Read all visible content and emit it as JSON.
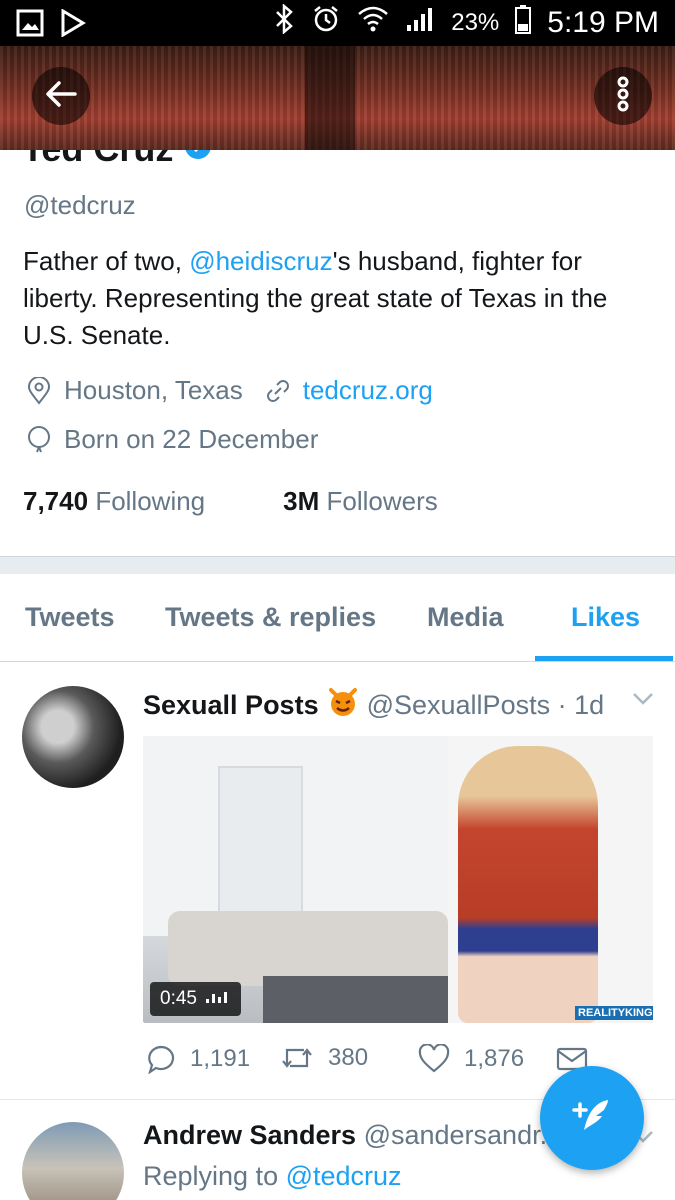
{
  "status_bar": {
    "battery": "23%",
    "time": "5:19 PM"
  },
  "profile": {
    "name": "Ted Cruz",
    "handle": "@tedcruz",
    "bio_pre": "Father of two, ",
    "bio_mention": "@heidiscruz",
    "bio_post": "'s husband, fighter for liberty. Representing the great state of Texas in the U.S. Senate.",
    "location": "Houston, Texas",
    "website": "tedcruz.org",
    "birthday": "Born on 22 December",
    "following_count": "7,740",
    "following_label": "Following",
    "followers_count": "3M",
    "followers_label": "Followers"
  },
  "tabs": [
    {
      "label": "Tweets"
    },
    {
      "label": "Tweets & replies"
    },
    {
      "label": "Media"
    },
    {
      "label": "Likes",
      "active": true
    }
  ],
  "tweets": [
    {
      "name": "Sexuall Posts",
      "handle_time": "@SexuallPosts · 1d",
      "video_duration": "0:45",
      "video_watermark": "REALITYKINGS.COM",
      "replies": "1,191",
      "retweets": "380",
      "likes": "1,876"
    },
    {
      "name": "Andrew Sanders",
      "handle": "@sandersandr...",
      "replying_prefix": "Replying to ",
      "replying_to": "@tedcruz"
    }
  ],
  "colors": {
    "accent": "#1da1f2",
    "secondary_text": "#657786",
    "primary_text": "#14171a"
  }
}
